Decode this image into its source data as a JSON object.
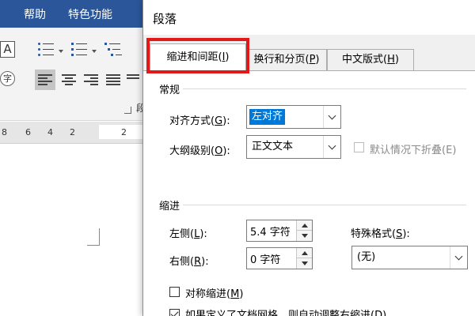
{
  "ribbon": {
    "tabs": [
      "帮助",
      "特色功能"
    ],
    "font_button": "A",
    "phonetic_button": "字",
    "group_label_fragment": "段",
    "accent_color": "#2b579a"
  },
  "ruler": {
    "numbers": [
      "8",
      "6",
      "4",
      "2",
      "2"
    ]
  },
  "dialog": {
    "title": "段落",
    "tabs": [
      {
        "label": "缩进和间距",
        "key": "I"
      },
      {
        "label": "换行和分页",
        "key": "P"
      },
      {
        "label": "中文版式",
        "key": "H"
      }
    ],
    "highlight_color": "#e11919",
    "general": {
      "section_title": "常规",
      "alignment_label": "对齐方式",
      "alignment_key": "G",
      "alignment_value": "左对齐",
      "outline_label": "大纲级别",
      "outline_key": "O",
      "outline_value": "正文文本",
      "collapse_label": "默认情况下折叠",
      "collapse_key": "E",
      "collapse_checked": false
    },
    "indent": {
      "section_title": "缩进",
      "left_label": "左侧",
      "left_key": "L",
      "left_value": "5.4 字符",
      "right_label": "右侧",
      "right_key": "R",
      "right_value": "0 字符",
      "special_label": "特殊格式",
      "special_key": "S",
      "special_value": "(无)",
      "mirror_label": "对称缩进",
      "mirror_key": "M",
      "mirror_checked": false,
      "grid_label": "如果定义了文档网格，则自动调整右缩进",
      "grid_key": "D",
      "grid_checked": true
    }
  }
}
